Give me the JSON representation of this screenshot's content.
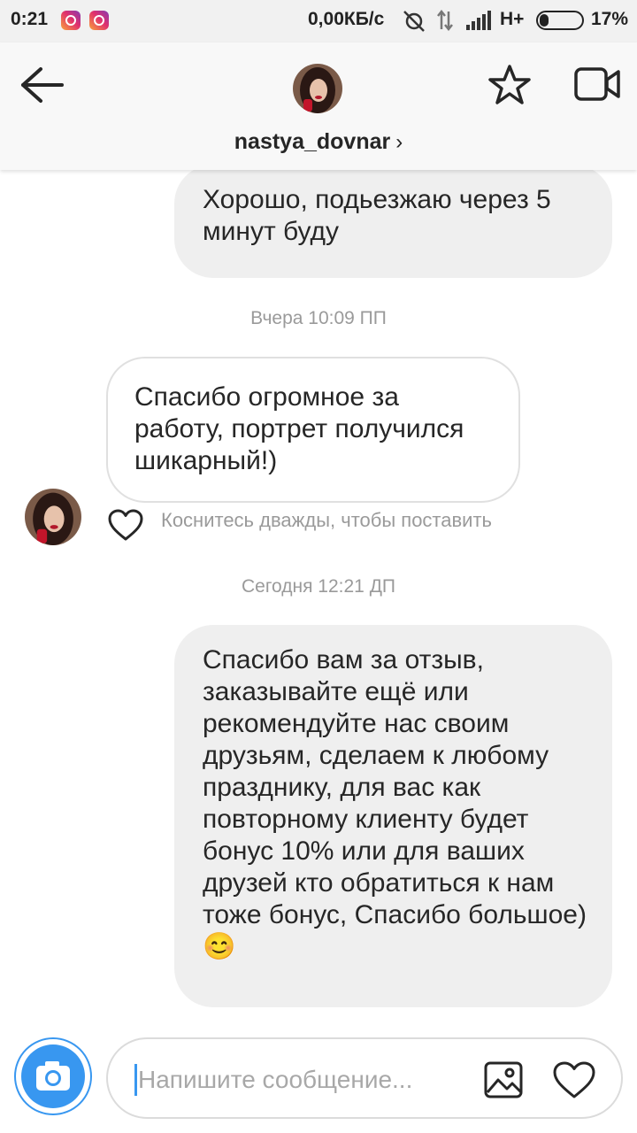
{
  "status_bar": {
    "time": "0:21",
    "speed": "0,00КБ/с",
    "network": "H+",
    "battery": "17%"
  },
  "header": {
    "username": "nastya_dovnar",
    "chevron": "›",
    "icons": [
      "back-arrow-icon",
      "star-icon",
      "video-call-icon"
    ]
  },
  "messages": [
    {
      "direction": "outgoing",
      "text": "Хорошо, подьезжаю через 5 минут буду"
    },
    {
      "type": "timestamp",
      "text": "Вчера 10:09 ПП"
    },
    {
      "direction": "incoming",
      "text": "Спасибо огромное за работу, портрет получился шикарный!)"
    },
    {
      "type": "hint",
      "text": "Коснитесь дважды, чтобы поставить \"Нравится\""
    },
    {
      "type": "timestamp",
      "text": "Сегодня 12:21 ДП"
    },
    {
      "direction": "outgoing",
      "text": "Спасибо вам за отзыв, заказывайте ещё или рекомендуйте нас своим друзьям, сделаем к любому празднику, для вас как повторному клиенту будет бонус 10% или для ваших друзей кто обратиться к нам тоже бонус, Спасибо большое)😊"
    }
  ],
  "composer": {
    "placeholder": "Напишите сообщение..."
  },
  "colors": {
    "accent": "#3897f0",
    "outgoing_bubble": "#efefef",
    "header_bg": "#f8f8f8"
  }
}
